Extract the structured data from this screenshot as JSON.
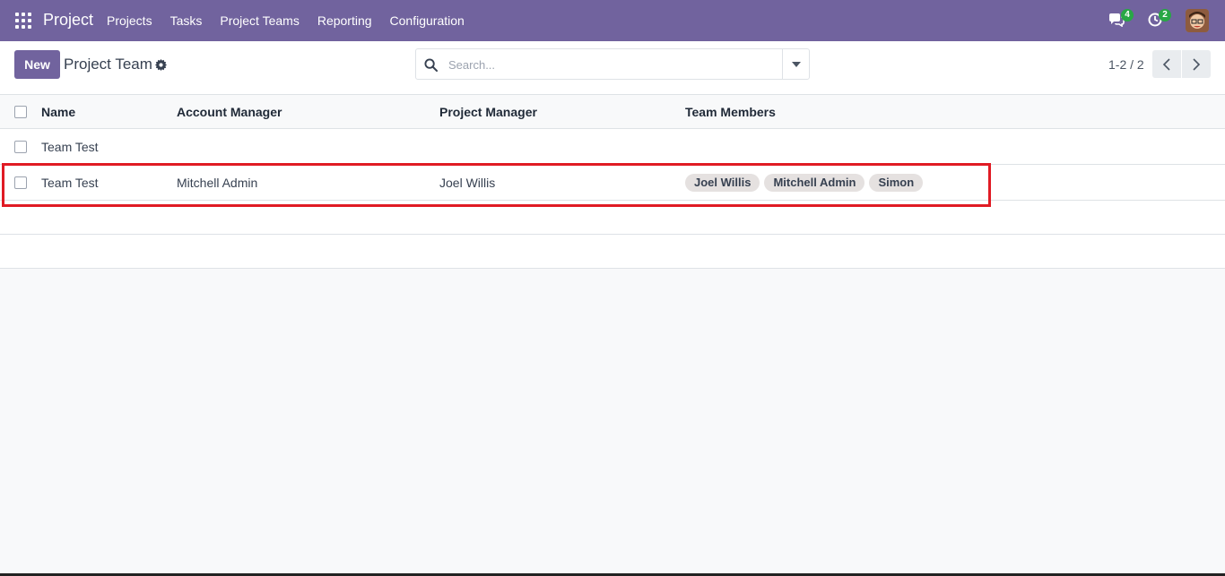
{
  "navbar": {
    "app_title": "Project",
    "menu": [
      "Projects",
      "Tasks",
      "Project Teams",
      "Reporting",
      "Configuration"
    ],
    "messages_count": "4",
    "activities_count": "2",
    "bg_color": "#71639e",
    "badge_color": "#28a745"
  },
  "control_panel": {
    "new_label": "New",
    "title": "Project Team",
    "search_placeholder": "Search...",
    "pager": "1-2 / 2"
  },
  "table": {
    "columns": [
      "Name",
      "Account Manager",
      "Project Manager",
      "Team Members"
    ],
    "rows": [
      {
        "name": "Team Test",
        "account_manager": "",
        "project_manager": "",
        "team_members": []
      },
      {
        "name": "Team Test",
        "account_manager": "Mitchell Admin",
        "project_manager": "Joel Willis",
        "team_members": [
          "Joel Willis",
          "Mitchell Admin",
          "Simon"
        ]
      }
    ]
  },
  "highlight_color": "#e01b24"
}
